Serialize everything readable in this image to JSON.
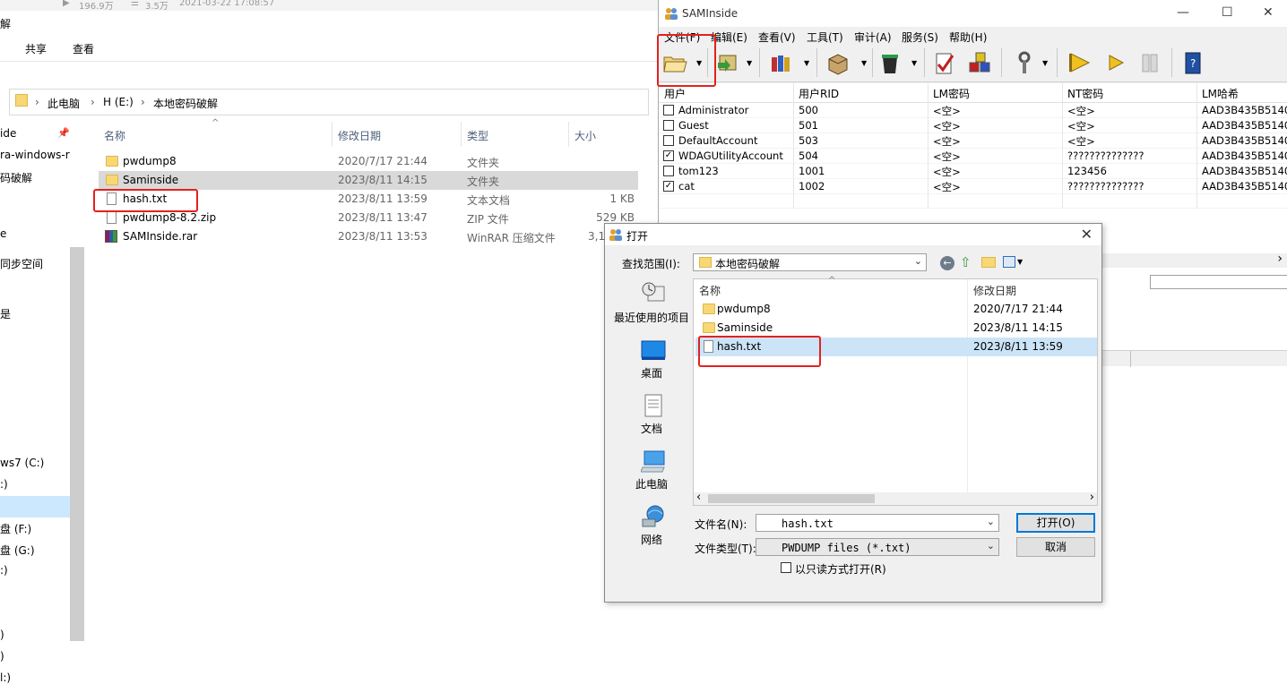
{
  "explorer": {
    "top_strip": {
      "views": "196.9万",
      "comments": "3.5万",
      "datetime": "2021-03-22 17:08:57"
    },
    "ribbon": {
      "left_tab_partial": "解",
      "tab_share": "共享",
      "tab_view": "查看"
    },
    "breadcrumb": [
      "此电脑",
      "H (E:)",
      "本地密码破解"
    ],
    "nav_items": [
      "ide",
      "ra-windows-r",
      "码破解",
      "e",
      "同步空间",
      "是",
      "ws7 (C:)",
      ":)",
      "盘 (F:)",
      "盘 (G:)",
      ":)",
      ")",
      ")",
      "l:)"
    ],
    "columns": {
      "name": "名称",
      "date": "修改日期",
      "type": "类型",
      "size": "大小"
    },
    "files": [
      {
        "name": "pwdump8",
        "date": "2020/7/17 21:44",
        "type": "文件夹",
        "size": "",
        "icon": "folder-icon"
      },
      {
        "name": "Saminside",
        "date": "2023/8/11 14:15",
        "type": "文件夹",
        "size": "",
        "icon": "folder-icon"
      },
      {
        "name": "hash.txt",
        "date": "2023/8/11 13:59",
        "type": "文本文档",
        "size": "1 KB",
        "icon": "text-file-icon"
      },
      {
        "name": "pwdump8-8.2.zip",
        "date": "2023/8/11 13:47",
        "type": "ZIP 文件",
        "size": "529 KB",
        "icon": "zip-file-icon"
      },
      {
        "name": "SAMInside.rar",
        "date": "2023/8/11 13:53",
        "type": "WinRAR 压缩文件",
        "size": "3,1",
        "icon": "rar-file-icon"
      }
    ]
  },
  "saminside": {
    "title": "SAMInside",
    "window_buttons": {
      "minimize": "—",
      "maximize": "☐",
      "close": "✕"
    },
    "menu": [
      "文件(F)",
      "编辑(E)",
      "查看(V)",
      "工具(T)",
      "审计(A)",
      "服务(S)",
      "帮助(H)"
    ],
    "columns": [
      "用户",
      "用户RID",
      "LM密码",
      "NT密码",
      "LM哈希"
    ],
    "users": [
      {
        "user": "Administrator",
        "rid": "500",
        "lm": "<空>",
        "nt": "<空>",
        "lmhash": "AAD3B435B5140",
        "checked": false
      },
      {
        "user": "Guest",
        "rid": "501",
        "lm": "<空>",
        "nt": "<空>",
        "lmhash": "AAD3B435B5140",
        "checked": false
      },
      {
        "user": "DefaultAccount",
        "rid": "503",
        "lm": "<空>",
        "nt": "<空>",
        "lmhash": "AAD3B435B5140",
        "checked": false
      },
      {
        "user": "WDAGUtilityAccount",
        "rid": "504",
        "lm": "<空>",
        "nt": "??????????????",
        "lmhash": "AAD3B435B5140",
        "checked": true
      },
      {
        "user": "tom123",
        "rid": "1001",
        "lm": "<空>",
        "nt": "123456",
        "lmhash": "AAD3B435B5140",
        "checked": false
      },
      {
        "user": "cat",
        "rid": "1002",
        "lm": "<空>",
        "nt": "??????????????",
        "lmhash": "AAD3B435B5140",
        "checked": true
      }
    ],
    "scroll_arrow": "›"
  },
  "dialog": {
    "title": "打开",
    "close": "✕",
    "lookin_label": "查找范围(I):",
    "lookin_value": "本地密码破解",
    "places": [
      "最近使用的项目",
      "桌面",
      "文档",
      "此电脑",
      "网络"
    ],
    "columns": {
      "name": "名称",
      "date": "修改日期"
    },
    "files": [
      {
        "name": "pwdump8",
        "date": "2020/7/17 21:44",
        "icon": "folder-icon"
      },
      {
        "name": "Saminside",
        "date": "2023/8/11 14:15",
        "icon": "folder-icon"
      },
      {
        "name": "hash.txt",
        "date": "2023/8/11 13:59",
        "icon": "text-file-icon"
      }
    ],
    "filename_label": "文件名(N):",
    "filename_value": "hash.txt",
    "filetype_label": "文件类型(T):",
    "filetype_value": "PWDUMP files (*.txt)",
    "readonly_label": "以只读方式打开(R)",
    "open_button": "打开(O)",
    "cancel_button": "取消",
    "arrow_left": "‹",
    "arrow_right": "›"
  },
  "colors": {
    "highlight_red": "#e4211d",
    "selection_blue": "#cce4f7",
    "accent": "#0078d7"
  }
}
